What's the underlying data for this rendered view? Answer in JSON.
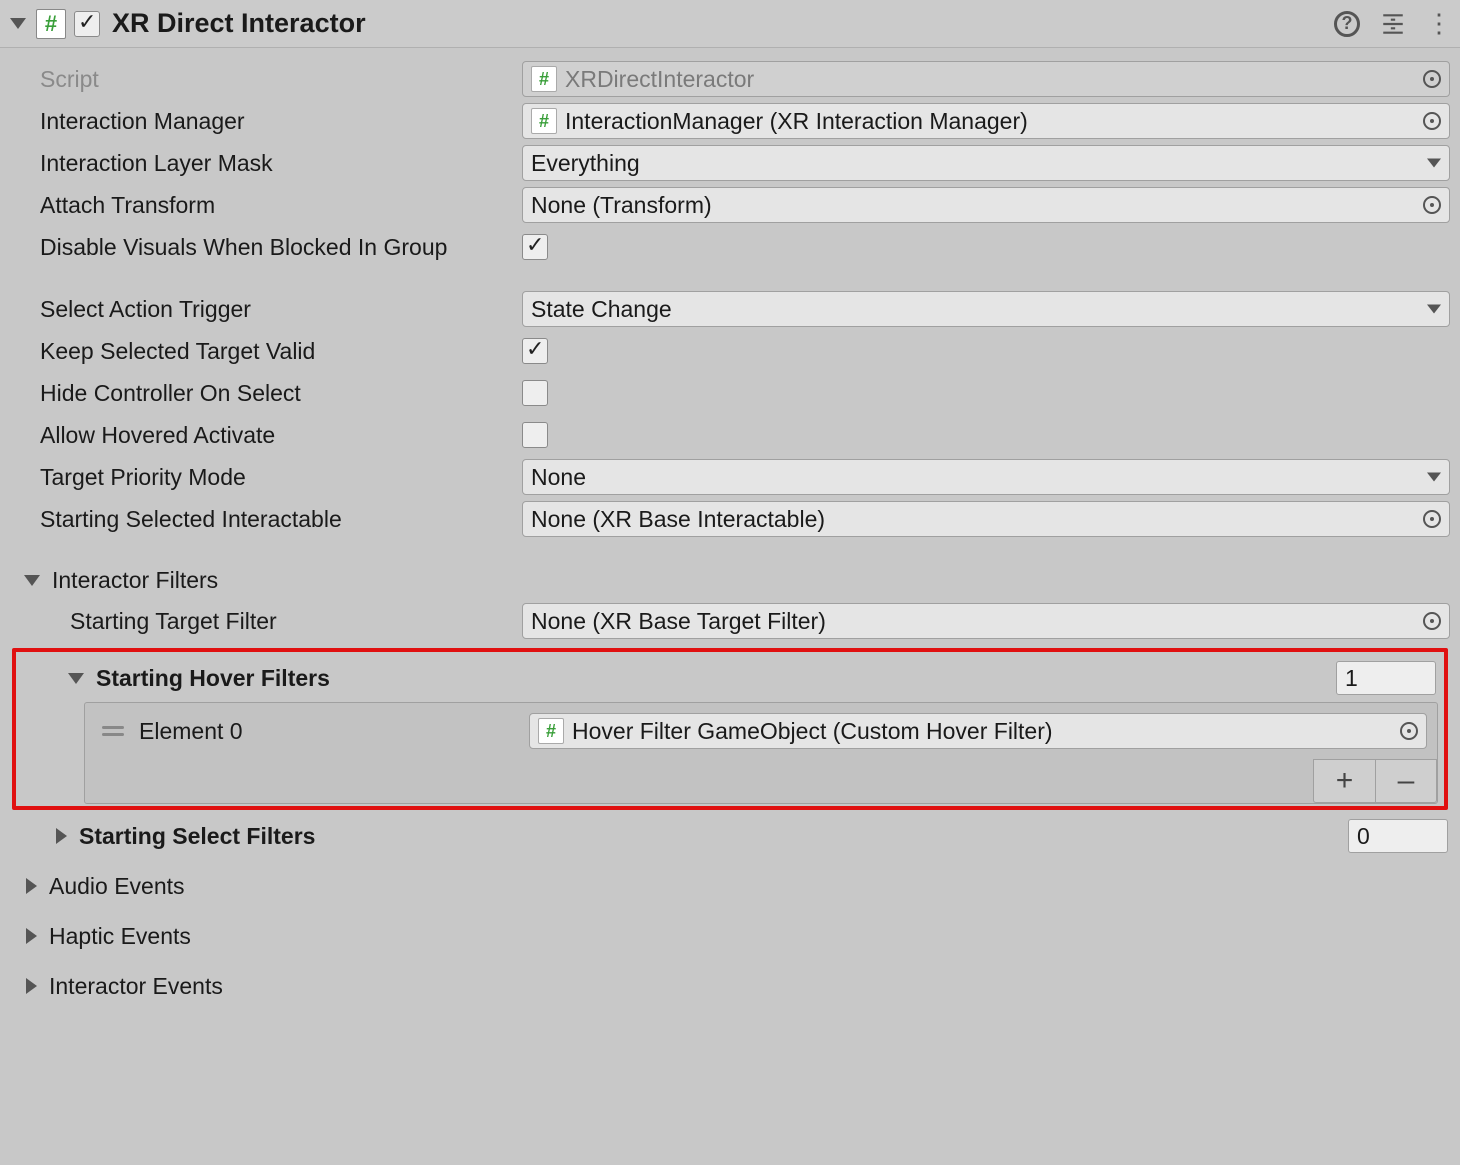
{
  "header": {
    "title": "XR Direct Interactor",
    "enabled": true
  },
  "props": {
    "script_label": "Script",
    "script_value": "XRDirectInteractor",
    "interaction_manager_label": "Interaction Manager",
    "interaction_manager_value": "InteractionManager (XR Interaction Manager)",
    "interaction_layer_mask_label": "Interaction Layer Mask",
    "interaction_layer_mask_value": "Everything",
    "attach_transform_label": "Attach Transform",
    "attach_transform_value": "None (Transform)",
    "disable_visuals_label": "Disable Visuals When Blocked In Group",
    "disable_visuals_value": true,
    "select_action_trigger_label": "Select Action Trigger",
    "select_action_trigger_value": "State Change",
    "keep_selected_label": "Keep Selected Target Valid",
    "keep_selected_value": true,
    "hide_controller_label": "Hide Controller On Select",
    "hide_controller_value": false,
    "allow_hovered_label": "Allow Hovered Activate",
    "allow_hovered_value": false,
    "target_priority_label": "Target Priority Mode",
    "target_priority_value": "None",
    "starting_selected_label": "Starting Selected Interactable",
    "starting_selected_value": "None (XR Base Interactable)"
  },
  "filters": {
    "section_label": "Interactor Filters",
    "starting_target_filter_label": "Starting Target Filter",
    "starting_target_filter_value": "None (XR Base Target Filter)",
    "hover": {
      "header": "Starting Hover Filters",
      "count": "1",
      "element0_label": "Element 0",
      "element0_value": "Hover Filter GameObject (Custom Hover Filter)"
    },
    "select": {
      "header": "Starting Select Filters",
      "count": "0"
    }
  },
  "events": {
    "audio": "Audio Events",
    "haptic": "Haptic Events",
    "interactor": "Interactor Events"
  },
  "buttons": {
    "plus": "+",
    "minus": "–"
  }
}
